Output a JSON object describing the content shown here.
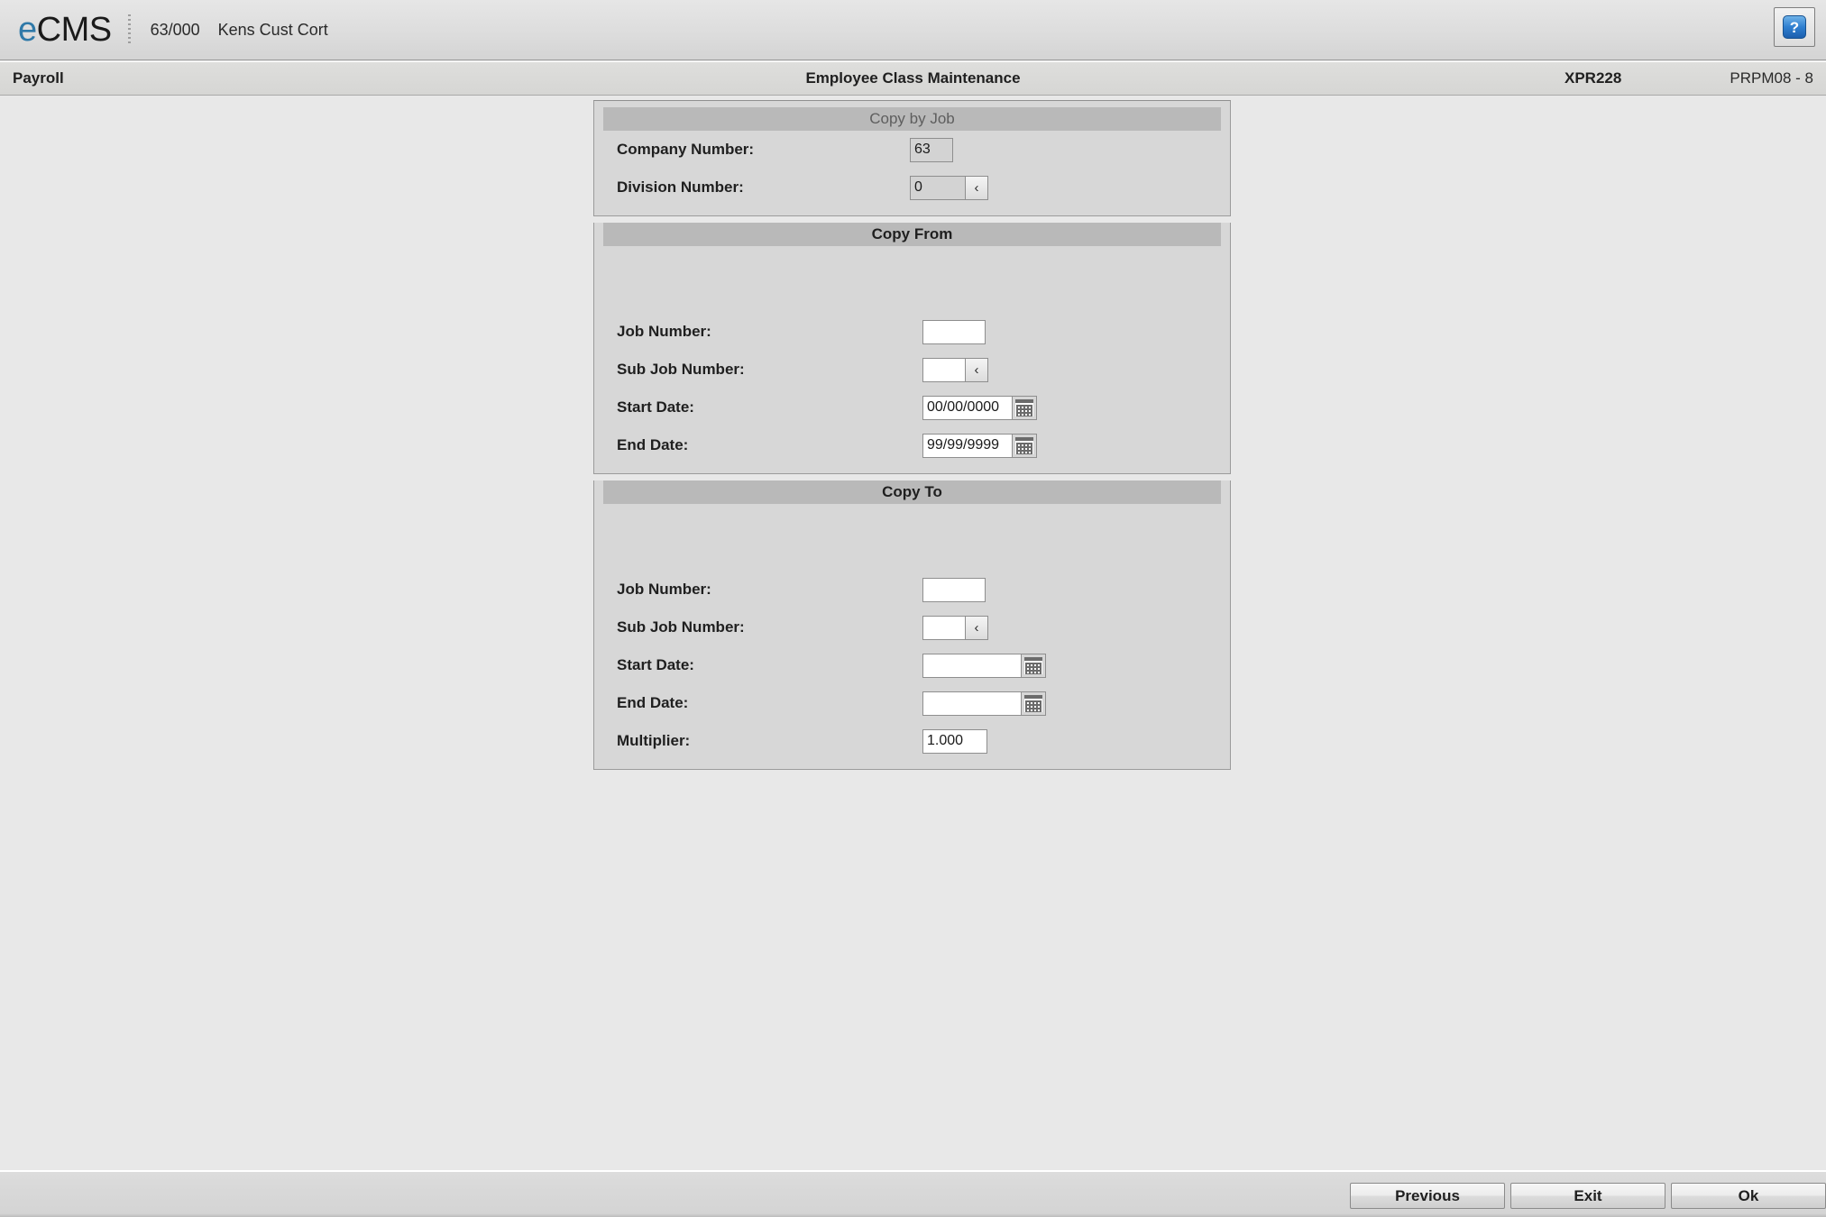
{
  "topbar": {
    "logo_e": "e",
    "logo_cms": "CMS",
    "company_code": "63/000",
    "company_name": "Kens Cust Cort",
    "help_glyph": "?"
  },
  "subheader": {
    "module": "Payroll",
    "screen_title": "Employee Class Maintenance",
    "program_id": "XPR228",
    "session_id": "PRPM08 - 8"
  },
  "panels": {
    "copy_by_job": {
      "header": "Copy by Job",
      "company_number_label": "Company Number:",
      "company_number_value": "63",
      "division_number_label": "Division Number:",
      "division_number_value": "0",
      "lookup_glyph": "‹"
    },
    "copy_from": {
      "header": "Copy From",
      "job_number_label": "Job Number:",
      "job_number_value": "",
      "sub_job_number_label": "Sub Job Number:",
      "sub_job_number_value": "",
      "lookup_glyph": "‹",
      "start_date_label": "Start Date:",
      "start_date_value": "00/00/0000",
      "end_date_label": "End Date:",
      "end_date_value": "99/99/9999"
    },
    "copy_to": {
      "header": "Copy To",
      "job_number_label": "Job Number:",
      "job_number_value": "",
      "sub_job_number_label": "Sub Job Number:",
      "sub_job_number_value": "",
      "lookup_glyph": "‹",
      "start_date_label": "Start Date:",
      "start_date_value": "",
      "end_date_label": "End Date:",
      "end_date_value": "",
      "multiplier_label": "Multiplier:",
      "multiplier_value": "1.000"
    }
  },
  "footer": {
    "previous_label": "Previous",
    "exit_label": "Exit",
    "ok_label": "Ok"
  },
  "colors": {
    "logo_blue": "#2f79a8",
    "panel_bg": "#d7d7d7",
    "panel_header_bg": "#b9b9b9",
    "page_bg": "#e8e8e8"
  }
}
